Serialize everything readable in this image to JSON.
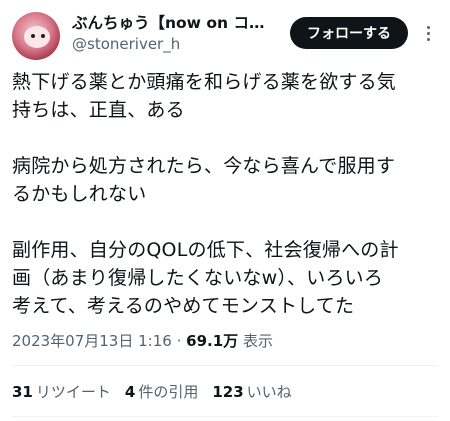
{
  "user": {
    "display_name": "ぶんちゅう【now on コ…",
    "handle": "@stoneriver_h",
    "follow_label": "フォローする"
  },
  "tweet": {
    "paragraphs": [
      [
        "熱下げる薬とか頭痛を和らげる薬を欲する気",
        "持ちは、正直、ある"
      ],
      [
        "病院から処方されたら、今なら喜んで服用す",
        "るかもしれない"
      ],
      [
        "副作用、自分のQOLの低下、社会復帰への計",
        "画（あまり復帰したくないなw）、いろいろ",
        "考えて、考えるのやめてモンストしてた"
      ]
    ]
  },
  "meta": {
    "timestamp": "2023年07月13日 1:16",
    "separator": "·",
    "views": "69.1万",
    "views_label": "表示"
  },
  "stats": {
    "retweets": "31",
    "retweets_label": "リツイート",
    "quotes": "4",
    "quotes_label": "件の引用",
    "likes": "123",
    "likes_label": "いいね"
  }
}
